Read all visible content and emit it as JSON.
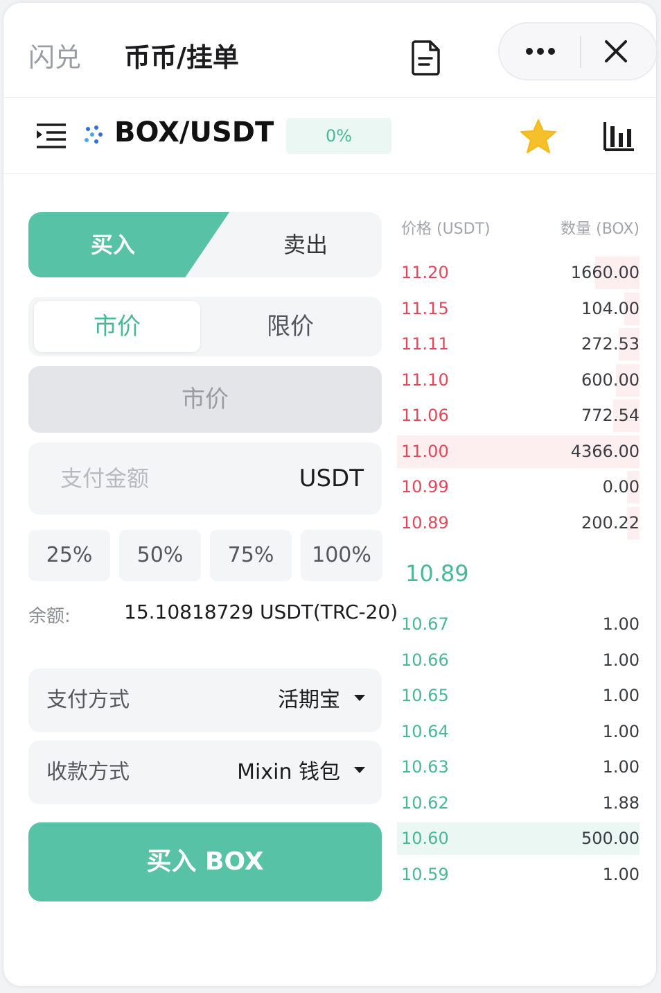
{
  "header": {
    "tab_flash": "闪兑",
    "tab_coin": "币币/挂单",
    "icons": [
      "document-icon",
      "more-icon",
      "close-icon"
    ]
  },
  "pair": {
    "name": "BOX/USDT",
    "change": "0%",
    "icons": [
      "menu-icon",
      "coin-icon",
      "star-icon",
      "chart-icon"
    ],
    "star_color": "#f5c02c"
  },
  "form": {
    "buy_label": "买入",
    "sell_label": "卖出",
    "market_label": "市价",
    "limit_label": "限价",
    "price_field_label": "市价",
    "amount_placeholder": "支付金额",
    "amount_unit": "USDT",
    "percents": [
      "25%",
      "50%",
      "75%",
      "100%"
    ],
    "balance_label": "余额:",
    "balance_value": "15.10818729 USDT(TRC-20)",
    "pay_method_label": "支付方式",
    "pay_method_value": "活期宝",
    "receive_method_label": "收款方式",
    "receive_method_value": "Mixin 钱包",
    "submit_label": "买入 BOX"
  },
  "orderbook": {
    "price_header": "价格 (USDT)",
    "qty_header": "数量 (BOX)",
    "asks": [
      {
        "price": "11.20",
        "qty": "1660.00",
        "depth": 0.38
      },
      {
        "price": "11.15",
        "qty": "104.00",
        "depth": 0.06
      },
      {
        "price": "11.11",
        "qty": "272.53",
        "depth": 0.12
      },
      {
        "price": "11.10",
        "qty": "600.00",
        "depth": 0.15
      },
      {
        "price": "11.06",
        "qty": "772.54",
        "depth": 0.18
      },
      {
        "price": "11.00",
        "qty": "4366.00",
        "depth": 1.0
      },
      {
        "price": "10.99",
        "qty": "0.00",
        "depth": 0.03
      },
      {
        "price": "10.89",
        "qty": "200.22",
        "depth": 0.03
      }
    ],
    "last_price": "10.89",
    "bids": [
      {
        "price": "10.67",
        "qty": "1.00",
        "depth": 0.0
      },
      {
        "price": "10.66",
        "qty": "1.00",
        "depth": 0.0
      },
      {
        "price": "10.65",
        "qty": "1.00",
        "depth": 0.0
      },
      {
        "price": "10.64",
        "qty": "1.00",
        "depth": 0.0
      },
      {
        "price": "10.63",
        "qty": "1.00",
        "depth": 0.0
      },
      {
        "price": "10.62",
        "qty": "1.88",
        "depth": 0.0
      },
      {
        "price": "10.60",
        "qty": "500.00",
        "depth": 1.0
      },
      {
        "price": "10.59",
        "qty": "1.00",
        "depth": 0.0
      }
    ],
    "ask_color": "#e5475a",
    "bid_color": "#49b896"
  },
  "colors": {
    "accent": "#57c2a6",
    "accent_text": "#49b896"
  }
}
